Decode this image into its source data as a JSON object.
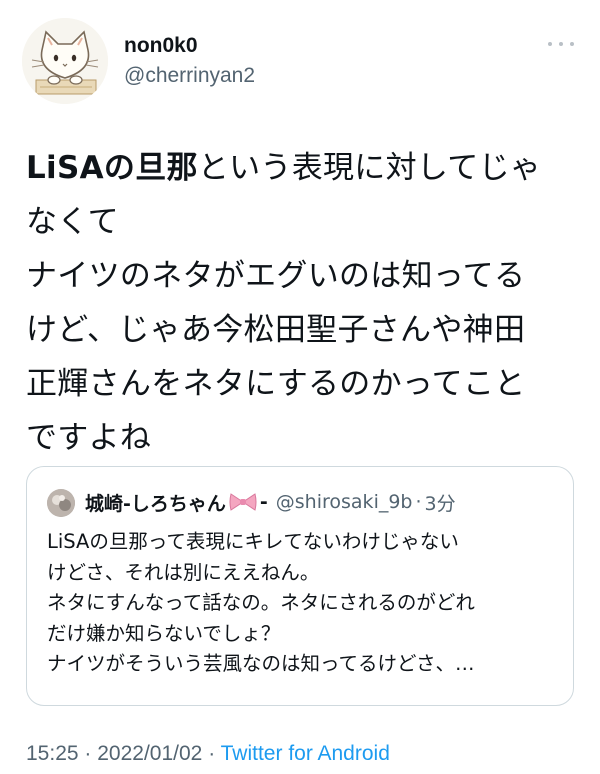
{
  "author": {
    "display_name": "non0k0",
    "handle": "@cherrinyan2",
    "avatar_icon": "cat-avatar-icon"
  },
  "more_icon": "more-options-icon",
  "tweet": {
    "lines": [
      {
        "bold": "LiSAの旦那",
        "rest": "という表現に対してじゃ"
      },
      {
        "text": "なくて"
      },
      {
        "text": "ナイツのネタがエグいのは知ってる"
      },
      {
        "text": "けど、じゃあ今松田聖子さんや神田"
      },
      {
        "text": "正輝さんをネタにするのかってこと"
      },
      {
        "text": "ですよね"
      }
    ]
  },
  "quoted": {
    "name": "城崎-しろちゃん",
    "name_suffix": "-",
    "bow_icon": "ribbon-bow-icon",
    "handle": "@shirosaki_9b",
    "separator": "·",
    "time": "3分",
    "lines": [
      "LiSAの旦那って表現にキレてないわけじゃない",
      "けどさ、それは別にええねん。",
      "ネタにすんなって話なの。ネタにされるのがどれ",
      "だけ嫌か知らないでしょ？",
      "ナイツがそういう芸風なのは知ってるけどさ、…"
    ]
  },
  "footer": {
    "time": "15:25",
    "separator1": "·",
    "date": "2022/01/02",
    "separator2": "·",
    "source": "Twitter for Android"
  },
  "colors": {
    "text": "#0f1419",
    "secondary": "#536471",
    "link": "#1d9bf0",
    "border": "#cfd9de",
    "bow": "#f4a6c0"
  }
}
